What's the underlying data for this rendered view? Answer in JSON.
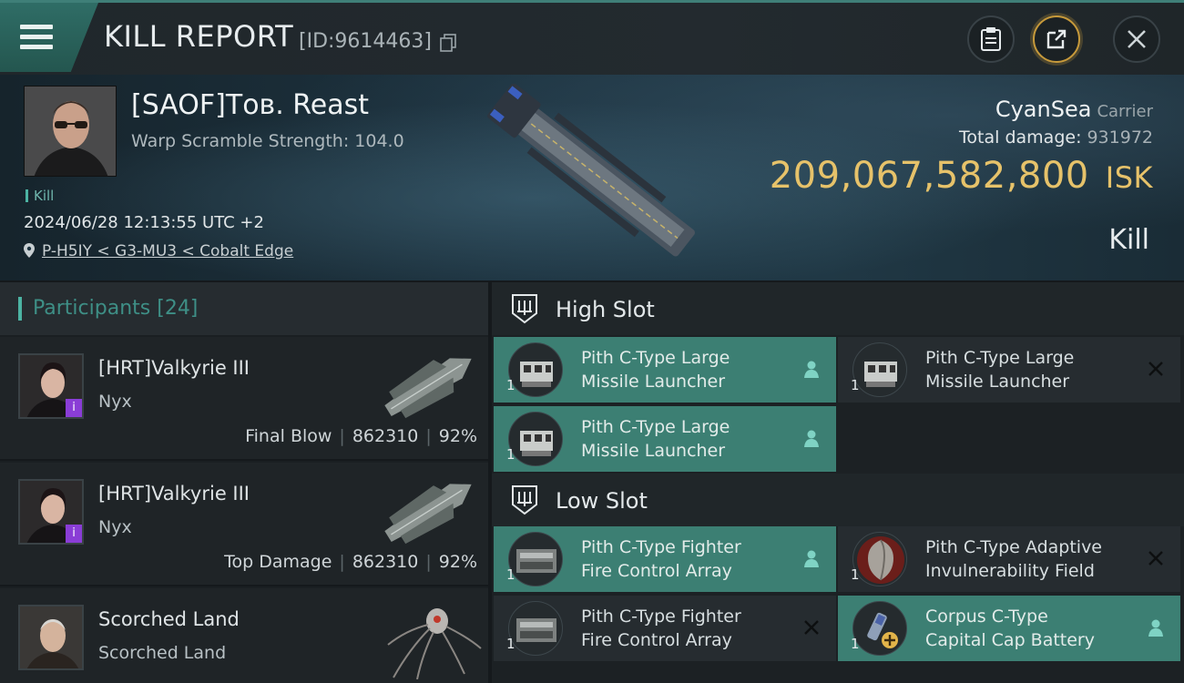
{
  "header": {
    "title": "KILL REPORT",
    "report_id": "[ID:9614463]",
    "icons": [
      "menu-icon",
      "copy-icon",
      "clipboard-icon",
      "share-icon",
      "close-icon"
    ]
  },
  "victim": {
    "pilot": "[SAOF]Тов. Reast",
    "warp_scramble": "Warp Scramble Strength: 104.0",
    "kill_tag": "Kill",
    "datetime": "2024/06/28 12:13:55 UTC +2",
    "location": "P-H5IY < G3-MU3 < Cobalt Edge",
    "ship_name": "CyanSea",
    "ship_class": "Carrier",
    "total_damage_label": "Total damage:",
    "total_damage": "931972",
    "isk_value": "209,067,582,800",
    "isk_unit": "ISK",
    "result": "Kill"
  },
  "participants": {
    "label": "Participants",
    "count": "[24]",
    "rows": [
      {
        "name": "[HRT]Valkyrie III",
        "ship": "Nyx",
        "role": "Final Blow",
        "damage": "862310",
        "percent": "92%"
      },
      {
        "name": "[HRT]Valkyrie III",
        "ship": "Nyx",
        "role": "Top Damage",
        "damage": "862310",
        "percent": "92%"
      },
      {
        "name": "Scorched Land",
        "ship": "Scorched Land",
        "role": "",
        "damage": "",
        "percent": ""
      }
    ]
  },
  "slots": {
    "high": {
      "label": "High Slot",
      "modules": [
        {
          "qty": "1",
          "name1": "Pith C-Type Large",
          "name2": "Missile Launcher",
          "state": "active",
          "mark": "person"
        },
        {
          "qty": "1",
          "name1": "Pith C-Type Large",
          "name2": "Missile Launcher",
          "state": "inactive",
          "mark": "x"
        },
        {
          "qty": "1",
          "name1": "Pith C-Type Large",
          "name2": "Missile Launcher",
          "state": "active",
          "mark": "person"
        }
      ]
    },
    "low": {
      "label": "Low Slot",
      "modules": [
        {
          "qty": "1",
          "name1": "Pith C-Type Fighter",
          "name2": "Fire Control Array",
          "state": "active",
          "mark": "person"
        },
        {
          "qty": "1",
          "name1": "Pith C-Type Adaptive",
          "name2": "Invulnerability Field",
          "state": "inactive",
          "mark": "x"
        },
        {
          "qty": "1",
          "name1": "Pith C-Type Fighter",
          "name2": "Fire Control Array",
          "state": "inactive",
          "mark": "x"
        },
        {
          "qty": "1",
          "name1": "Corpus C-Type",
          "name2": "Capital Cap Battery",
          "state": "active",
          "mark": "person"
        }
      ]
    }
  },
  "colors": {
    "accent": "#4cb3a3",
    "isk": "#e6c26a",
    "active_module": "#3c7f73"
  }
}
